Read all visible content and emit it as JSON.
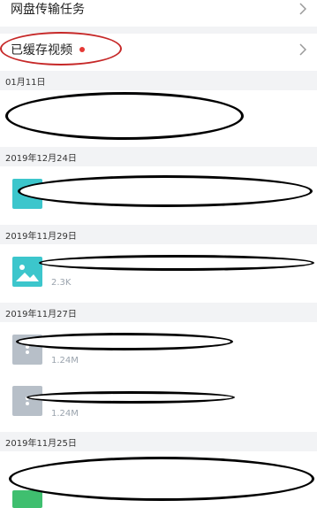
{
  "nav": {
    "transfer_label": "网盘传输任务",
    "cached_label": "已缓存视频"
  },
  "groups": [
    {
      "date": "01月11日"
    },
    {
      "date": "2019年12月24日"
    },
    {
      "date": "2019年11月29日",
      "size": "2.3K"
    },
    {
      "date": "2019年11月27日",
      "sizes": [
        "1.24M",
        "1.24M"
      ]
    },
    {
      "date": "2019年11月25日"
    }
  ],
  "colors": {
    "accent_teal": "#3cc6cc",
    "doc_gray": "#b7bfc8",
    "annotation_red": "#c62828",
    "badge_red": "#e53935"
  },
  "icons": [
    "chevron-right-icon",
    "image-file-icon",
    "document-file-icon"
  ]
}
